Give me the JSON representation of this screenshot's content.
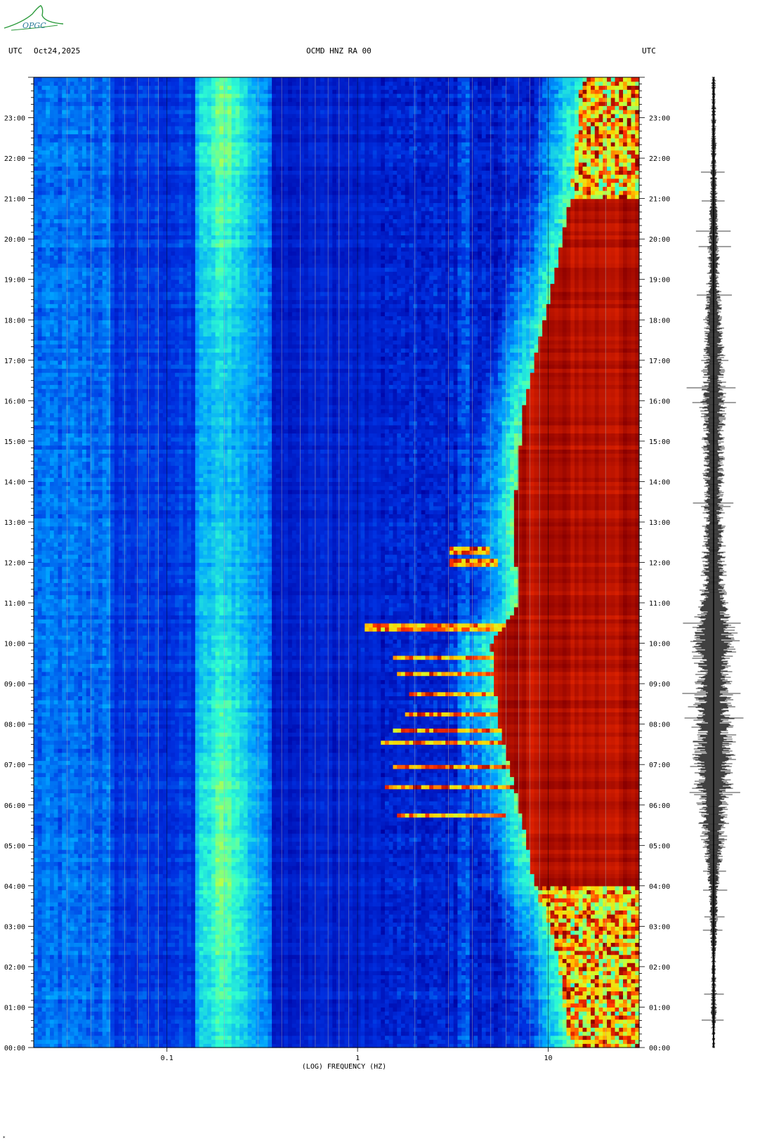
{
  "header": {
    "left_timezone": "UTC",
    "date": "Oct24,2025",
    "station": "OCMD HNZ RA 00",
    "right_timezone": "UTC"
  },
  "logo": {
    "text": "OPGC",
    "color": "#2a9a3a"
  },
  "chart_data": {
    "type": "heatmap",
    "title": "OCMD HNZ RA 00",
    "xlabel": "(LOG) FREQUENCY (HZ)",
    "ylabel": "",
    "x_scale": "log",
    "xlim": [
      0.02,
      30
    ],
    "x_ticks": [
      {
        "value": 0.1,
        "label": "0.1"
      },
      {
        "value": 1,
        "label": "1"
      },
      {
        "value": 10,
        "label": "10"
      }
    ],
    "ylim": [
      0,
      24
    ],
    "y_ticks": [
      {
        "value": 0,
        "label": "00:00"
      },
      {
        "value": 1,
        "label": "01:00"
      },
      {
        "value": 2,
        "label": "02:00"
      },
      {
        "value": 3,
        "label": "03:00"
      },
      {
        "value": 4,
        "label": "04:00"
      },
      {
        "value": 5,
        "label": "05:00"
      },
      {
        "value": 6,
        "label": "06:00"
      },
      {
        "value": 7,
        "label": "07:00"
      },
      {
        "value": 8,
        "label": "08:00"
      },
      {
        "value": 9,
        "label": "09:00"
      },
      {
        "value": 10,
        "label": "10:00"
      },
      {
        "value": 11,
        "label": "11:00"
      },
      {
        "value": 12,
        "label": "12:00"
      },
      {
        "value": 13,
        "label": "13:00"
      },
      {
        "value": 14,
        "label": "14:00"
      },
      {
        "value": 15,
        "label": "15:00"
      },
      {
        "value": 16,
        "label": "16:00"
      },
      {
        "value": 17,
        "label": "17:00"
      },
      {
        "value": 18,
        "label": "18:00"
      },
      {
        "value": 19,
        "label": "19:00"
      },
      {
        "value": 20,
        "label": "20:00"
      },
      {
        "value": 21,
        "label": "21:00"
      },
      {
        "value": 22,
        "label": "22:00"
      },
      {
        "value": 23,
        "label": "23:00"
      }
    ],
    "colormap": [
      "#0000a0",
      "#0030e0",
      "#00a0ff",
      "#30ffd0",
      "#d0ff30",
      "#ffd000",
      "#ff3000",
      "#8b0000"
    ],
    "high_energy_cutoff_hz": [
      {
        "hour": 0,
        "hz": 13
      },
      {
        "hour": 2.5,
        "hz": 11
      },
      {
        "hour": 4,
        "hz": 8.5
      },
      {
        "hour": 6,
        "hz": 7
      },
      {
        "hour": 8,
        "hz": 5.5
      },
      {
        "hour": 10,
        "hz": 5
      },
      {
        "hour": 11,
        "hz": 7
      },
      {
        "hour": 13,
        "hz": 6.5
      },
      {
        "hour": 16,
        "hz": 7.5
      },
      {
        "hour": 18,
        "hz": 9.5
      },
      {
        "hour": 21,
        "hz": 13
      },
      {
        "hour": 24,
        "hz": 15
      }
    ],
    "quiet_periods": [
      [
        0,
        4
      ],
      [
        21,
        24
      ]
    ],
    "events": [
      {
        "hour": 5.75,
        "fmin": 1.6,
        "fmax": 6.0
      },
      {
        "hour": 6.45,
        "fmin": 1.4,
        "fmax": 8.0
      },
      {
        "hour": 6.95,
        "fmin": 1.5,
        "fmax": 7.5
      },
      {
        "hour": 7.55,
        "fmin": 1.3,
        "fmax": 7.0
      },
      {
        "hour": 7.85,
        "fmin": 1.5,
        "fmax": 6.5
      },
      {
        "hour": 8.25,
        "fmin": 1.8,
        "fmax": 6.0
      },
      {
        "hour": 8.75,
        "fmin": 1.9,
        "fmax": 6.5
      },
      {
        "hour": 9.25,
        "fmin": 1.6,
        "fmax": 7.0
      },
      {
        "hour": 9.65,
        "fmin": 1.5,
        "fmax": 6.0
      },
      {
        "hour": 10.4,
        "fmin": 1.1,
        "fmax": 9.0
      },
      {
        "hour": 12.0,
        "fmin": 3.0,
        "fmax": 5.5
      },
      {
        "hour": 12.3,
        "fmin": 3.0,
        "fmax": 5.0
      }
    ],
    "microseism_band_hz": [
      0.14,
      0.35
    ],
    "seismogram_amplitude_by_hour": [
      {
        "hour": 0,
        "amp": 0.05
      },
      {
        "hour": 1,
        "amp": 0.12
      },
      {
        "hour": 2,
        "amp": 0.08
      },
      {
        "hour": 3,
        "amp": 0.15
      },
      {
        "hour": 4,
        "amp": 0.2
      },
      {
        "hour": 5,
        "amp": 0.45
      },
      {
        "hour": 6,
        "amp": 0.6
      },
      {
        "hour": 7,
        "amp": 0.85
      },
      {
        "hour": 8,
        "amp": 0.75
      },
      {
        "hour": 9,
        "amp": 0.7
      },
      {
        "hour": 10,
        "amp": 0.95
      },
      {
        "hour": 11,
        "amp": 0.55
      },
      {
        "hour": 12,
        "amp": 0.45
      },
      {
        "hour": 13,
        "amp": 0.4
      },
      {
        "hour": 14,
        "amp": 0.4
      },
      {
        "hour": 15,
        "amp": 0.45
      },
      {
        "hour": 16,
        "amp": 0.5
      },
      {
        "hour": 17,
        "amp": 0.4
      },
      {
        "hour": 18,
        "amp": 0.35
      },
      {
        "hour": 19,
        "amp": 0.25
      },
      {
        "hour": 20,
        "amp": 0.2
      },
      {
        "hour": 21,
        "amp": 0.15
      },
      {
        "hour": 22,
        "amp": 0.12
      },
      {
        "hour": 23,
        "amp": 0.1
      },
      {
        "hour": 24,
        "amp": 0.08
      }
    ]
  }
}
